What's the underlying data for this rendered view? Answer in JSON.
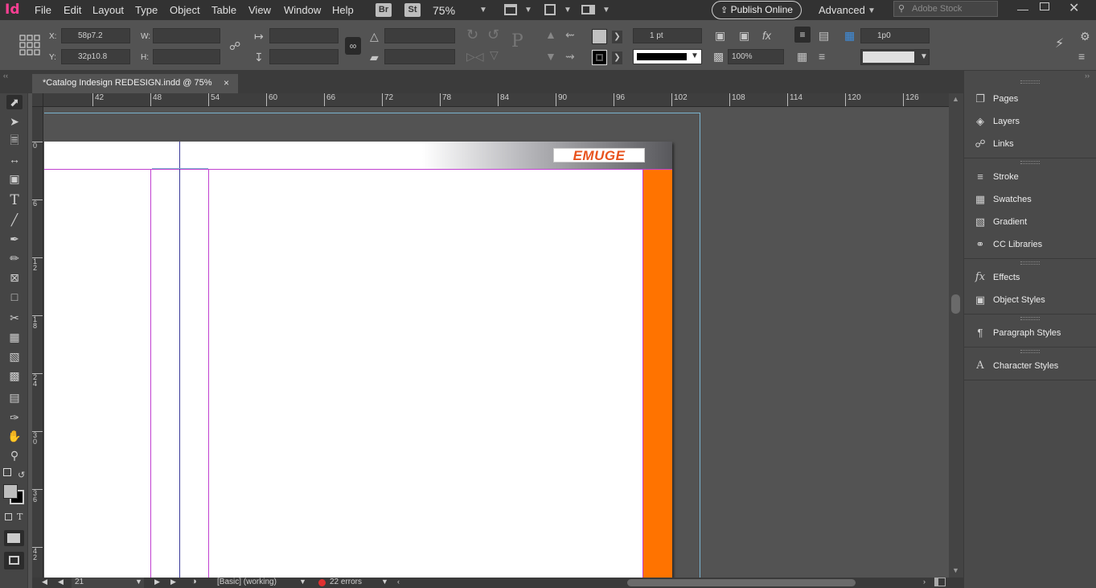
{
  "app": {
    "logo": "Id"
  },
  "menus": [
    "File",
    "Edit",
    "Layout",
    "Type",
    "Object",
    "Table",
    "View",
    "Window",
    "Help"
  ],
  "bridge": {
    "br": "Br",
    "st": "St"
  },
  "zoom": "75%",
  "publish_label": "Publish Online",
  "workspace": "Advanced",
  "search_placeholder": "Adobe Stock",
  "control": {
    "x_label": "X:",
    "x_value": "58p7.2",
    "y_label": "Y:",
    "y_value": "32p10.8",
    "w_label": "W:",
    "h_label": "H:",
    "stroke_weight": "1 pt",
    "opacity": "100%",
    "gap": "1p0"
  },
  "tab": {
    "title": "*Catalog Indesign REDESIGN.indd @ 75%",
    "close": "×"
  },
  "ruler": {
    "h": [
      "42",
      "48",
      "54",
      "60",
      "66",
      "72",
      "78",
      "84",
      "90",
      "96",
      "102",
      "108",
      "114",
      "120",
      "126"
    ],
    "v": [
      "0",
      "6",
      "1\n2",
      "1\n8",
      "2\n4",
      "3\n0",
      "3\n6",
      "4\n2"
    ]
  },
  "logo_text": "EMUGE",
  "status": {
    "page": "21",
    "style": "[Basic] (working)",
    "errors": "22 errors"
  },
  "panels": [
    {
      "label": "Pages",
      "icon": "pages-icon"
    },
    {
      "label": "Layers",
      "icon": "layers-icon"
    },
    {
      "label": "Links",
      "icon": "links-icon"
    },
    {
      "label": "Stroke",
      "icon": "stroke-icon"
    },
    {
      "label": "Swatches",
      "icon": "swatches-icon"
    },
    {
      "label": "Gradient",
      "icon": "gradient-icon"
    },
    {
      "label": "CC Libraries",
      "icon": "cc-libraries-icon"
    },
    {
      "label": "Effects",
      "icon": "effects-icon"
    },
    {
      "label": "Object Styles",
      "icon": "object-styles-icon"
    },
    {
      "label": "Paragraph Styles",
      "icon": "paragraph-styles-icon"
    },
    {
      "label": "Character Styles",
      "icon": "character-styles-icon"
    }
  ],
  "colors": {
    "accent_orange": "#ff7300",
    "logo_red": "#e8531e",
    "guide_purple": "#c040d0"
  }
}
